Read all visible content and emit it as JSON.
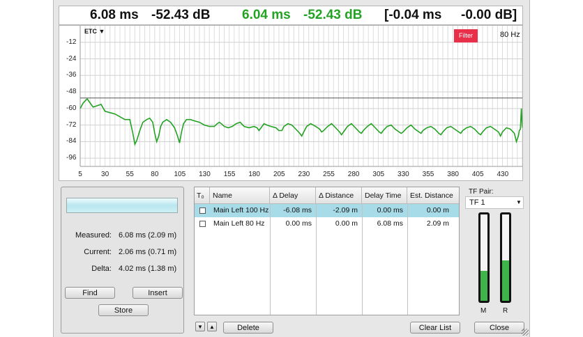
{
  "readout": {
    "meas_delay": "6.08 ms",
    "meas_level": "-52.43 dB",
    "live_delay": "6.04 ms",
    "live_level": "-52.43 dB",
    "diff_delay": "[-0.04 ms",
    "diff_level": "-0.00 dB]",
    "accent_green": "#23a223"
  },
  "plot": {
    "mode_label": "ETC ▼",
    "filter_label": "Filter",
    "filter_color": "#e8304a",
    "filter_freq": "80 Hz"
  },
  "chart_data": {
    "type": "line",
    "y_ticks": [
      "-12",
      "-24",
      "-36",
      "-48",
      "-60",
      "-72",
      "-84",
      "-96"
    ],
    "x_ticks": [
      "5",
      "30",
      "55",
      "80",
      "105",
      "130",
      "155",
      "180",
      "205",
      "230",
      "255",
      "280",
      "305",
      "330",
      "355",
      "380",
      "405",
      "430"
    ],
    "ylim": [
      -102,
      0
    ],
    "xlim": [
      5,
      450
    ],
    "reference_line_y": -52.4,
    "series": [
      {
        "color": "#23a223",
        "x": [
          5,
          8,
          12,
          15,
          18,
          22,
          26,
          30,
          35,
          40,
          45,
          50,
          55,
          58,
          60,
          62,
          65,
          68,
          72,
          75,
          78,
          80,
          82,
          84,
          86,
          88,
          92,
          96,
          100,
          103,
          105,
          107,
          109,
          112,
          116,
          120,
          125,
          130,
          135,
          140,
          143,
          145,
          147,
          150,
          154,
          158,
          162,
          166,
          170,
          175,
          180,
          183,
          185,
          188,
          190,
          193,
          197,
          202,
          205,
          208,
          210,
          214,
          218,
          222,
          226,
          228,
          230,
          233,
          237,
          242,
          246,
          248,
          250,
          254,
          258,
          262,
          266,
          268,
          270,
          274,
          278,
          282,
          286,
          288,
          290,
          294,
          298,
          302,
          306,
          308,
          310,
          314,
          318,
          322,
          326,
          328,
          330,
          334,
          338,
          342,
          346,
          348,
          350,
          354,
          358,
          362,
          366,
          368,
          370,
          374,
          378,
          382,
          386,
          388,
          390,
          394,
          398,
          402,
          406,
          408,
          410,
          414,
          418,
          422,
          426,
          428,
          430,
          434,
          438,
          442,
          444,
          446,
          447,
          448,
          449,
          450
        ],
        "y": [
          -60,
          -56,
          -53,
          -56,
          -59,
          -58,
          -57,
          -62,
          -63,
          -64,
          -66,
          -68,
          -68,
          -78,
          -86,
          -83,
          -76,
          -70,
          -68,
          -67,
          -70,
          -78,
          -84,
          -80,
          -73,
          -70,
          -68,
          -70,
          -74,
          -80,
          -85,
          -77,
          -71,
          -68,
          -68,
          -69,
          -70,
          -72,
          -73,
          -73,
          -71,
          -70,
          -71,
          -73,
          -74,
          -73,
          -71,
          -70,
          -73,
          -74,
          -73,
          -74,
          -76,
          -73,
          -71,
          -72,
          -73,
          -74,
          -76,
          -76,
          -73,
          -71,
          -72,
          -75,
          -78,
          -80,
          -77,
          -73,
          -71,
          -73,
          -75,
          -77,
          -76,
          -73,
          -71,
          -74,
          -77,
          -79,
          -77,
          -73,
          -71,
          -74,
          -77,
          -78,
          -76,
          -73,
          -71,
          -74,
          -77,
          -78,
          -76,
          -73,
          -72,
          -75,
          -77,
          -78,
          -77,
          -74,
          -72,
          -75,
          -77,
          -78,
          -76,
          -74,
          -73,
          -75,
          -78,
          -79,
          -77,
          -74,
          -73,
          -75,
          -77,
          -78,
          -76,
          -74,
          -73,
          -75,
          -78,
          -79,
          -77,
          -74,
          -73,
          -75,
          -77,
          -80,
          -77,
          -74,
          -75,
          -78,
          -84,
          -80,
          -76,
          -75,
          -60,
          -74
        ]
      }
    ]
  },
  "left_panel": {
    "measured_label": "Measured:",
    "measured_val": "6.08 ms  (2.09 m)",
    "current_label": "Current:",
    "current_val": "2.06 ms  (0.71 m)",
    "delta_label": "Delta:",
    "delta_val": "4.02 ms  (1.38 m)",
    "find": "Find",
    "insert": "Insert",
    "store": "Store"
  },
  "table": {
    "headers": [
      "T₀",
      "Name",
      "Δ Delay",
      "Δ Distance",
      "Delay Time",
      "Est. Distance"
    ],
    "rows": [
      {
        "name": "Main Left 100 Hz",
        "delay": "-6.08 ms",
        "distance": "-2.09 m",
        "delay_time": "0.00 ms",
        "est": "0.00 m",
        "selected": true
      },
      {
        "name": "Main Left 80 Hz",
        "delay": "0.00 ms",
        "distance": "0.00 m",
        "delay_time": "6.08 ms",
        "est": "2.09 m",
        "selected": false
      }
    ],
    "selection_color": "#a8dbe8"
  },
  "bottom": {
    "delete": "Delete",
    "clear_list": "Clear List",
    "close": "Close"
  },
  "tf": {
    "label": "TF Pair:",
    "selected": "TF 1",
    "meter_m_label": "M",
    "meter_r_label": "R",
    "meter_m_level": 0.35,
    "meter_r_level": 0.47,
    "meter_color": "#3eb44a"
  }
}
